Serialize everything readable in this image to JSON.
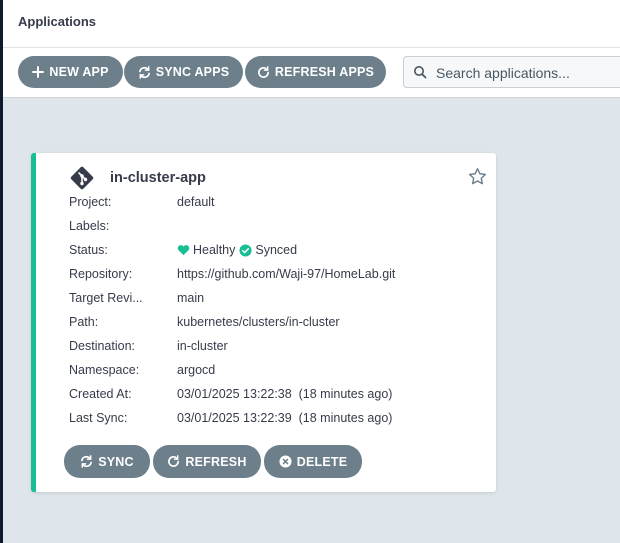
{
  "header": {
    "title": "Applications"
  },
  "toolbar": {
    "new_app": "NEW APP",
    "sync_apps": "SYNC APPS",
    "refresh_apps": "REFRESH APPS",
    "search_placeholder": "Search applications..."
  },
  "app": {
    "name": "in-cluster-app",
    "fields": [
      {
        "label": "Project:",
        "value": "default"
      },
      {
        "label": "Labels:",
        "value": ""
      },
      {
        "label": "Status:",
        "health": "Healthy",
        "sync": "Synced"
      },
      {
        "label": "Repository:",
        "value": "https://github.com/Waji-97/HomeLab.git"
      },
      {
        "label": "Target Revi...",
        "value": "main"
      },
      {
        "label": "Path:",
        "value": "kubernetes/clusters/in-cluster"
      },
      {
        "label": "Destination:",
        "value": "in-cluster"
      },
      {
        "label": "Namespace:",
        "value": "argocd"
      },
      {
        "label": "Created At:",
        "value": "03/01/2025 13:22:38  (18 minutes ago)"
      },
      {
        "label": "Last Sync:",
        "value": "03/01/2025 13:22:39  (18 minutes ago)"
      }
    ],
    "actions": {
      "sync": "SYNC",
      "refresh": "REFRESH",
      "delete": "DELETE"
    }
  },
  "colors": {
    "healthy": "#18be94",
    "button": "#6d7f8b",
    "accent_border": "#18be94"
  }
}
